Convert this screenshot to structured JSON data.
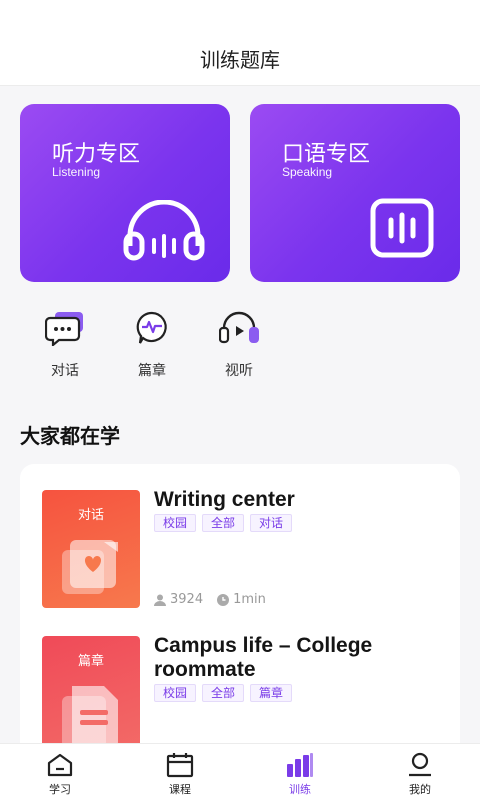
{
  "header": {
    "title": "训练题库"
  },
  "zones": [
    {
      "title": "听力专区",
      "subtitle": "Listening",
      "icon": "headphones-icon"
    },
    {
      "title": "口语专区",
      "subtitle": "Speaking",
      "icon": "voice-wave-icon"
    }
  ],
  "quick_links": [
    {
      "label": "对话",
      "icon": "chat-bubble-icon"
    },
    {
      "label": "篇章",
      "icon": "pulse-bubble-icon"
    },
    {
      "label": "视听",
      "icon": "headphone-play-icon"
    }
  ],
  "section": {
    "title": "大家都在学"
  },
  "courses": [
    {
      "thumb_label": "对话",
      "title": "Writing center",
      "tags": [
        "校园",
        "全部",
        "对话"
      ],
      "learners": "3924",
      "duration": "1min"
    },
    {
      "thumb_label": "篇章",
      "title": "Campus life – College roommate",
      "tags": [
        "校园",
        "全部",
        "篇章"
      ],
      "learners": "",
      "duration": ""
    }
  ],
  "tabbar": {
    "items": [
      {
        "label": "学习",
        "icon": "home-icon"
      },
      {
        "label": "课程",
        "icon": "calendar-icon"
      },
      {
        "label": "训练",
        "icon": "bar-chart-icon"
      },
      {
        "label": "我的",
        "icon": "profile-icon"
      }
    ],
    "active_index": 2
  },
  "colors": {
    "accent": "#7a3ce8",
    "card_gradient_start": "#9b4bf2",
    "card_gradient_end": "#6a2bea"
  }
}
